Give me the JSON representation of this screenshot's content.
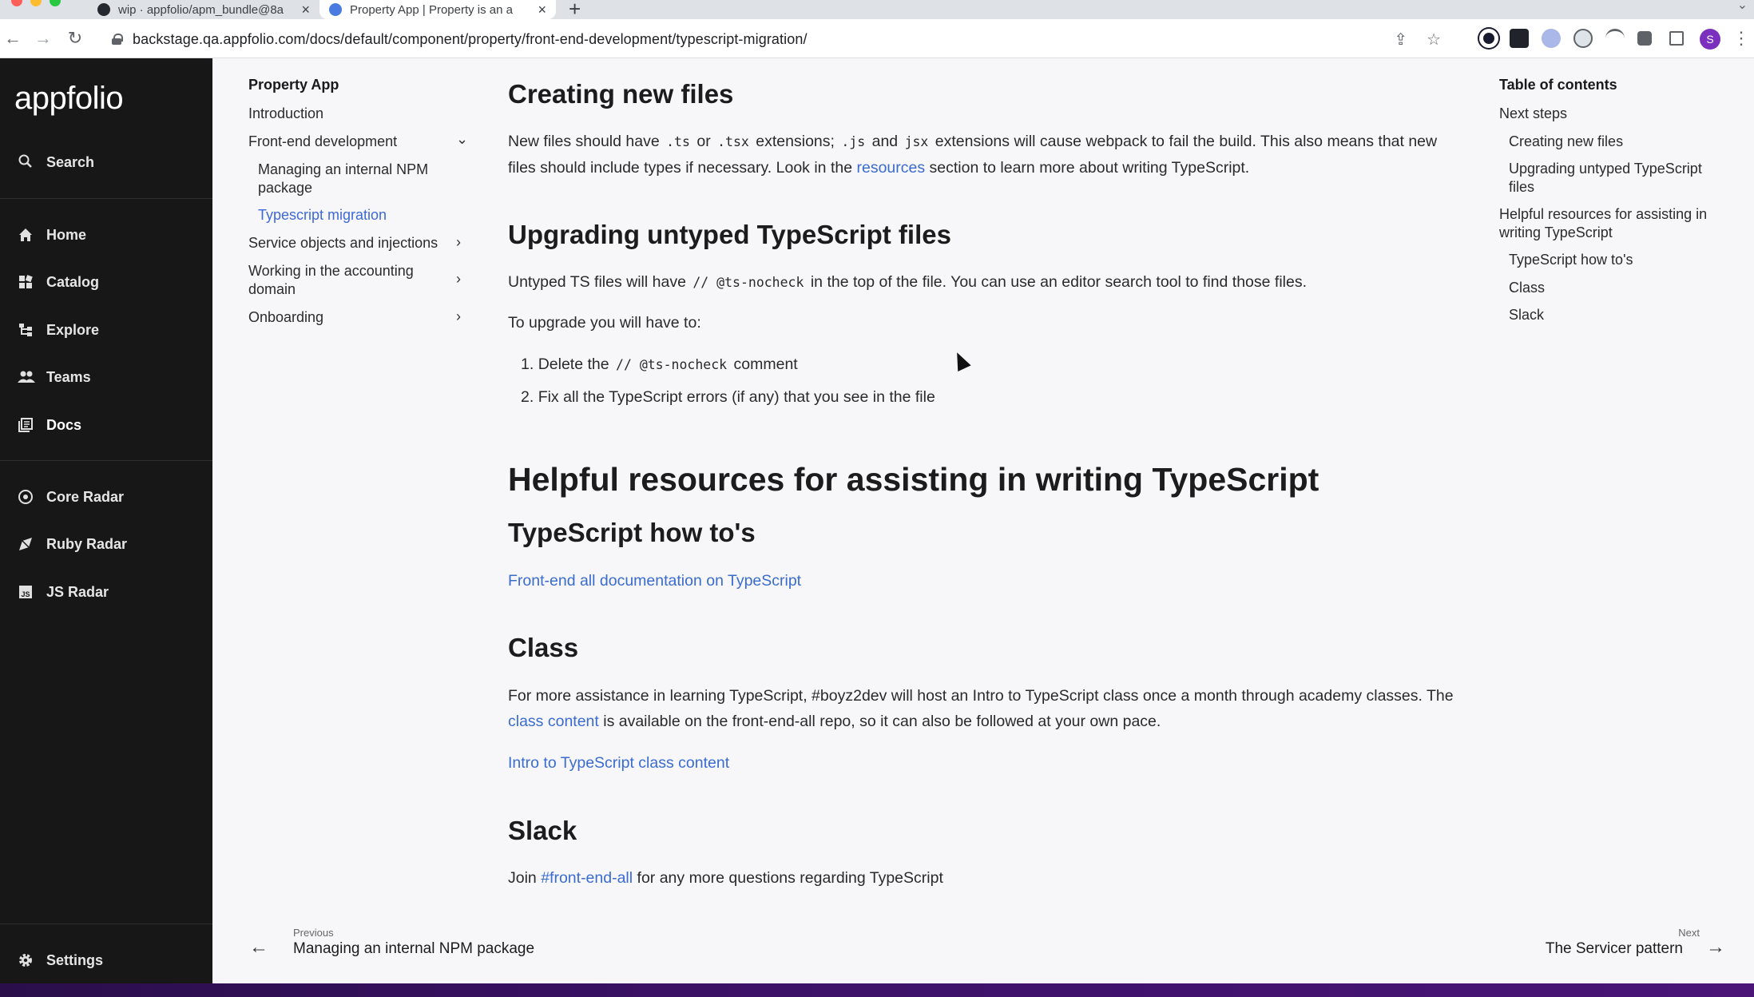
{
  "browser": {
    "tabs": [
      {
        "title": "wip · appfolio/apm_bundle@8a",
        "active": false
      },
      {
        "title": "Property App | Property is an a",
        "active": true
      }
    ],
    "url": "backstage.qa.appfolio.com/docs/default/component/property/front-end-development/typescript-migration/",
    "profile_initial": "S"
  },
  "sidebar": {
    "logo": "appfolio",
    "search_label": "Search",
    "items": [
      {
        "label": "Home",
        "icon": "home-icon"
      },
      {
        "label": "Catalog",
        "icon": "catalog-icon"
      },
      {
        "label": "Explore",
        "icon": "explore-icon"
      },
      {
        "label": "Teams",
        "icon": "teams-icon"
      },
      {
        "label": "Docs",
        "icon": "docs-icon"
      }
    ],
    "radar_items": [
      {
        "label": "Core Radar",
        "icon": "radar-icon"
      },
      {
        "label": "Ruby Radar",
        "icon": "ruby-radar-icon"
      },
      {
        "label": "JS Radar",
        "icon": "js-radar-icon"
      }
    ],
    "settings_label": "Settings"
  },
  "leftnav": {
    "title": "Property App",
    "items": {
      "introduction": "Introduction",
      "frontend": "Front-end development",
      "npm": "Managing an internal NPM package",
      "ts_migration": "Typescript migration",
      "service_objects": "Service objects and injections",
      "accounting": "Working in the accounting domain",
      "onboarding": "Onboarding"
    }
  },
  "content": {
    "creating": {
      "heading": "Creating new files",
      "p1_a": "New files should have",
      "code_ts": ".ts",
      "p1_or": "or",
      "code_tsx": ".tsx",
      "p1_b": "extensions;",
      "code_js": ".js",
      "p1_and": "and",
      "code_jsx": "jsx",
      "p1_c": "extensions will cause webpack to fail the build. This also means that new files should include types if necessary. Look in the",
      "resources_link": "resources",
      "p1_d": "section to learn more about writing TypeScript."
    },
    "upgrading": {
      "heading": "Upgrading untyped TypeScript files",
      "p1_a": "Untyped TS files will have",
      "code_nocheck": "// @ts-nocheck",
      "p1_b": "in the top of the file. You can use an editor search tool to find those files.",
      "p2": "To upgrade you will have to:",
      "step1_num": "1.",
      "step1_a": "Delete the",
      "step1_code": "// @ts-nocheck",
      "step1_b": "comment",
      "step2_num": "2.",
      "step2": "Fix all the TypeScript errors (if any) that you see in the file"
    },
    "helpful": {
      "heading": "Helpful resources for assisting in writing TypeScript"
    },
    "howtos": {
      "heading": "TypeScript how to's",
      "link": "Front-end all documentation on TypeScript"
    },
    "class": {
      "heading": "Class",
      "p1_a": "For more assistance in learning TypeScript, #boyz2dev will host an Intro to TypeScript class once a month through academy classes. The",
      "class_content_link": "class content",
      "p1_b": "is available on the front-end-all repo, so it can also be followed at your own pace.",
      "intro_link": "Intro to TypeScript class content"
    },
    "slack": {
      "heading": "Slack",
      "p_a": "Join",
      "channel_link": "#front-end-all",
      "p_b": "for any more questions regarding TypeScript"
    }
  },
  "toc": {
    "title": "Table of contents",
    "items": {
      "next_steps": "Next steps",
      "creating": "Creating new files",
      "upgrading": "Upgrading untyped TypeScript files",
      "helpful": "Helpful resources for assisting in writing TypeScript",
      "howtos": "TypeScript how to's",
      "class": "Class",
      "slack": "Slack"
    }
  },
  "pager": {
    "prev_label": "Previous",
    "prev_title": "Managing an internal NPM package",
    "next_label": "Next",
    "next_title": "The Servicer pattern"
  },
  "colors": {
    "sidebar_bg": "#171717",
    "link": "#3a6ccf",
    "page_bg": "#f7f6f9"
  }
}
